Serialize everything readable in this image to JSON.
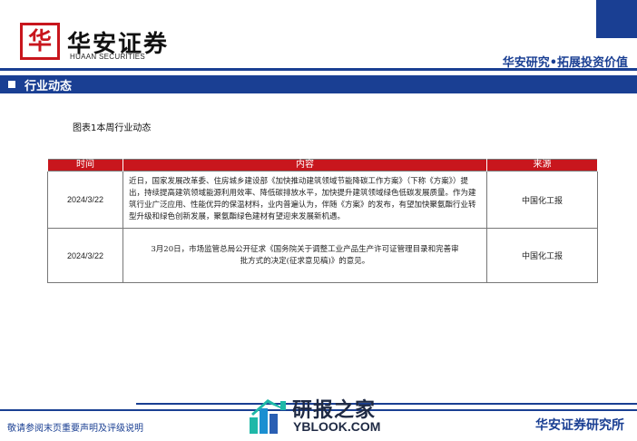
{
  "header": {
    "logo_glyph": "华",
    "brand_cn": "华安证券",
    "brand_en": "HUAAN SECURITIES",
    "slogan": "华安研究•拓展投资价值",
    "accent_color": "#1a3f93",
    "brand_red": "#c8161d"
  },
  "section": {
    "title": "行业动态"
  },
  "figure": {
    "caption": "图表1本周行业动态"
  },
  "table": {
    "headers": [
      "时间",
      "内容",
      "来源"
    ],
    "rows": [
      {
        "date": "2024/3/22",
        "content": "近日，国家发展改革委、住房城乡建设部《加快推动建筑领域节能降碳工作方案》（下称《方案》）提出，持续提高建筑领域能源利用效率、降低碳排放水平，加快提升建筑领域绿色低碳发展质量。作为建筑行业广泛应用、性能优异的保温材料，业内普遍认为，伴随《方案》的发布，有望加快聚氨酯行业转型升级和绿色创新发展，聚氨酯绿色建材有望迎来发展新机遇。",
        "source": "中国化工报"
      },
      {
        "date": "2024/3/22",
        "content": "3月20日，市场监管总局公开征求《国务院关于调整工业产品生产许可证管理目录和完善审批方式的决定(征求意见稿)》的意见。",
        "source": "中国化工报"
      }
    ]
  },
  "footer": {
    "disclaimer": "敬请参阅末页重要声明及评级说明",
    "institute": "华安证券研究所"
  },
  "watermark": {
    "cn": "研报之家",
    "url": "YBLOOK.COM"
  }
}
